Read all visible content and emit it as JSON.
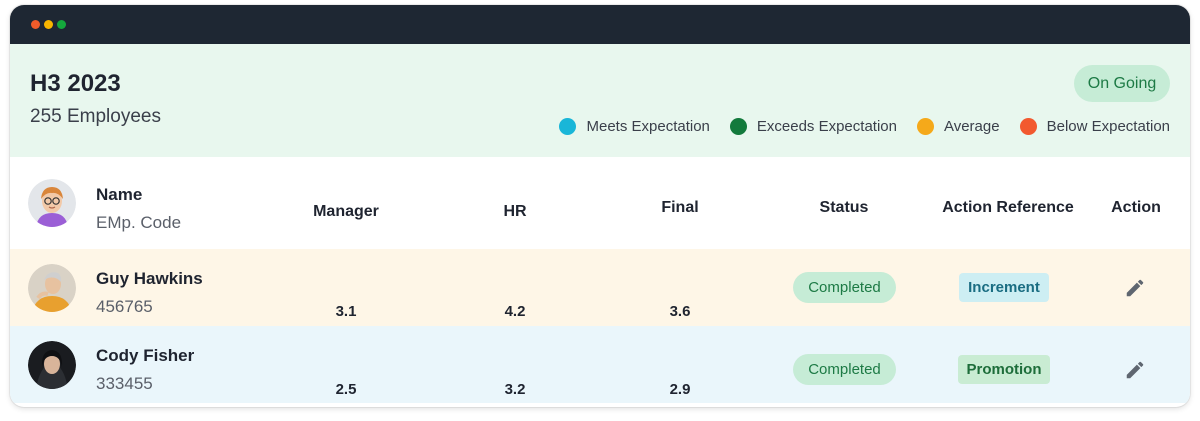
{
  "window": {
    "controls": [
      "close",
      "minimize",
      "maximize"
    ]
  },
  "summary": {
    "period": "H3 2023",
    "employee_count": "255 Employees",
    "status_badge": "On Going",
    "legend": [
      {
        "label": "Meets Expectation",
        "color": "#19b6d8"
      },
      {
        "label": "Exceeds Expectation",
        "color": "#137a3c"
      },
      {
        "label": "Average",
        "color": "#f5a91a"
      },
      {
        "label": "Below Expectation",
        "color": "#f2592f"
      }
    ]
  },
  "table": {
    "headers": {
      "name": "Name",
      "code": "EMp. Code",
      "manager": "Manager",
      "hr": "HR",
      "final": "Final",
      "status": "Status",
      "action_reference": "Action Reference",
      "action": "Action"
    },
    "rows": [
      {
        "name": "Guy Hawkins",
        "code": "456765",
        "manager": "3.1",
        "hr": "4.2",
        "final": "3.6",
        "status": "Completed",
        "action_reference": "Increment",
        "action_icon": "pencil-icon"
      },
      {
        "name": "Cody Fisher",
        "code": "333455",
        "manager": "2.5",
        "hr": "3.2",
        "final": "2.9",
        "status": "Completed",
        "action_reference": "Promotion",
        "action_icon": "pencil-icon"
      }
    ]
  }
}
